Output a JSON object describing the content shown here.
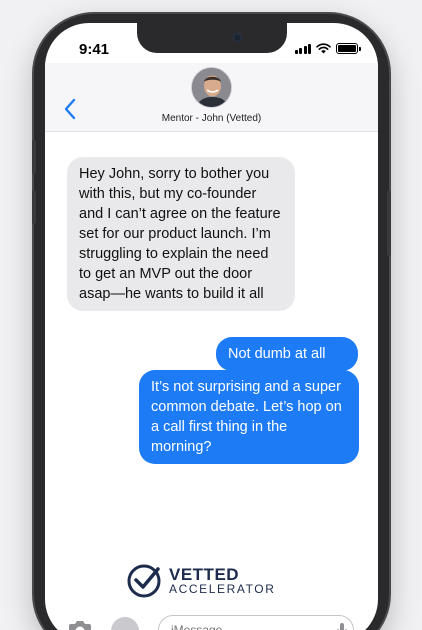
{
  "status_bar": {
    "time": "9:41"
  },
  "header": {
    "contact_name": "Mentor - John (Vetted)"
  },
  "messages": [
    {
      "direction": "incoming",
      "text": "Hey John, sorry to bother you with this, but my co-founder and I can’t agree on the feature set for our product launch. I’m struggling to explain the need to get an MVP out the door asap—he wants to build it all"
    },
    {
      "direction": "outgoing",
      "text": "Not dumb at all"
    },
    {
      "direction": "outgoing",
      "text": "It’s not surprising and a super common debate. Let’s hop on a call first thing in the morning?"
    }
  ],
  "logo": {
    "line1": "VETTED",
    "line2": "ACCELERATOR"
  },
  "input": {
    "placeholder": "iMessage"
  },
  "colors": {
    "outgoing_bubble": "#1d7bf5",
    "incoming_bubble": "#e9e9eb",
    "accent": "#1d7bf5",
    "logo": "#1d2b4d"
  }
}
